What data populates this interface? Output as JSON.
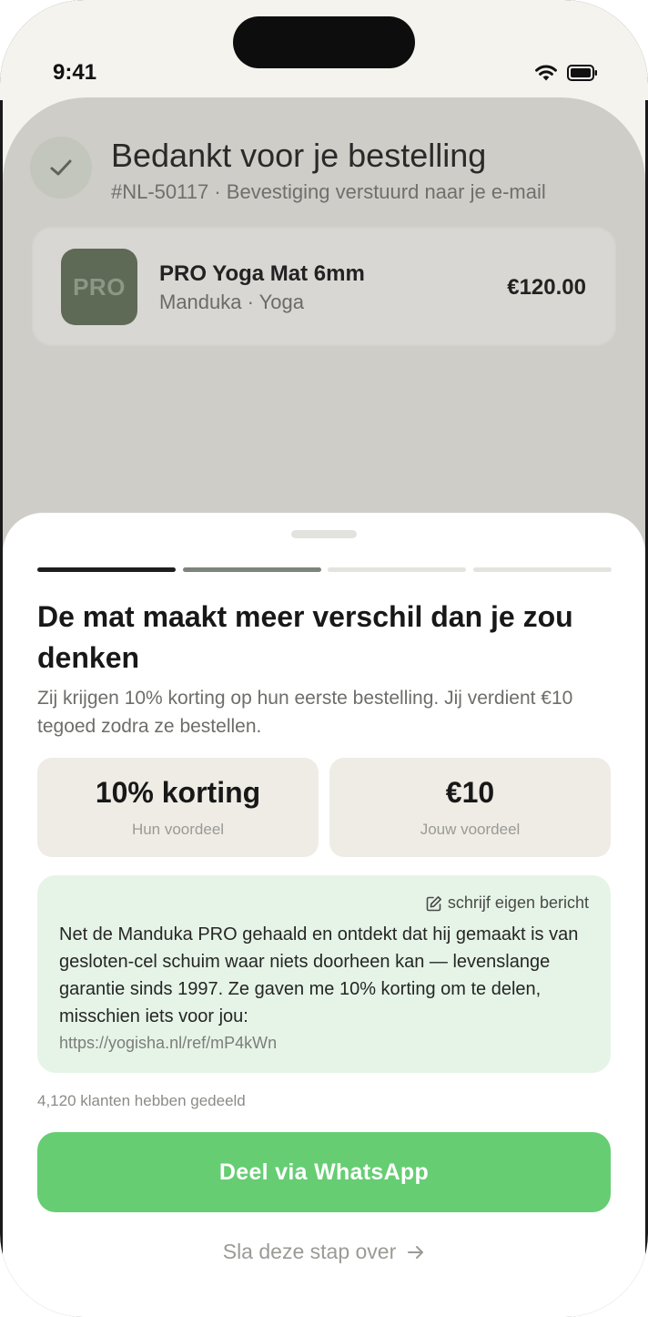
{
  "status_bar": {
    "time": "9:41"
  },
  "order": {
    "title": "Bedankt voor je bestelling",
    "subtitle": "#NL-50117 · Bevestiging verstuurd naar je e-mail",
    "item": {
      "thumb_label": "PRO",
      "name": "PRO Yoga Mat 6mm",
      "meta": "Manduka · Yoga",
      "price": "€120.00"
    }
  },
  "referral": {
    "progress": {
      "total_steps": 4,
      "current_step": 2
    },
    "headline": "De mat maakt meer verschil dan je zou denken",
    "subtext": "Zij krijgen 10% korting op hun eerste bestelling. Jij verdient €10 tegoed zodra ze bestellen.",
    "benefits": [
      {
        "value": "10% korting",
        "label": "Hun voordeel"
      },
      {
        "value": "€10",
        "label": "Jouw voordeel"
      }
    ],
    "message": {
      "edit_label": "schrijf eigen bericht",
      "text": "Net de Manduka PRO gehaald en ontdekt dat hij gemaakt is van gesloten-cel schuim waar niets doorheen kan — levenslange garantie sinds 1997. Ze gaven me 10% korting om te delen, misschien iets voor jou:",
      "link": "https://yogisha.nl/ref/mP4kWn"
    },
    "shared_count": "4,120 klanten hebben gedeeld",
    "cta_label": "Deel via WhatsApp",
    "skip_label": "Sla deze stap over"
  },
  "colors": {
    "cta": "#66cd73",
    "progress_active": "#1e1e1e",
    "progress_done": "#7c847c",
    "progress_pending": "#e4e3de",
    "message_bg": "#e6f4e8"
  },
  "icons": [
    "wifi-icon",
    "battery-icon",
    "check-icon",
    "edit-icon",
    "arrow-right-icon"
  ]
}
